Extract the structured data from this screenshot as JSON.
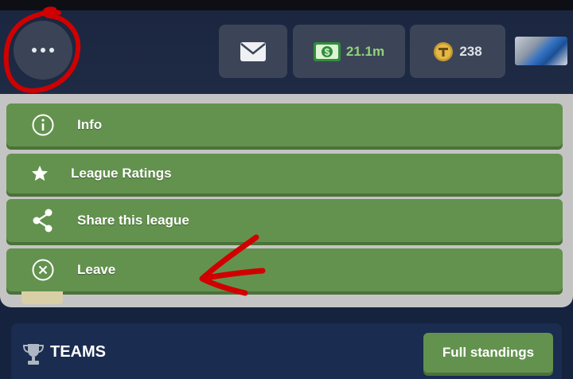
{
  "header": {
    "menu_icon": "more-dots-icon",
    "mail_icon": "mail-icon",
    "cash": {
      "icon": "cash-icon",
      "value": "21.1m",
      "color": "#8fd37a"
    },
    "coins": {
      "icon": "coin-icon",
      "value": "238"
    },
    "avatar_icon": "avatar-car-icon"
  },
  "menu": {
    "items": [
      {
        "label": "Info",
        "icon": "info-icon"
      },
      {
        "label": "League Ratings",
        "icon": "star-icon"
      },
      {
        "label": "Share this league",
        "icon": "share-icon"
      },
      {
        "label": "Leave",
        "icon": "close-circle-icon"
      }
    ]
  },
  "teams": {
    "title": "TEAMS",
    "icon": "trophy-icon",
    "full_standings_label": "Full standings"
  },
  "colors": {
    "button_green": "#63924e",
    "background": "#16233f",
    "annotation_red": "#d00000"
  },
  "annotations": [
    "red-circle-around-menu",
    "red-arrow-to-leave"
  ]
}
